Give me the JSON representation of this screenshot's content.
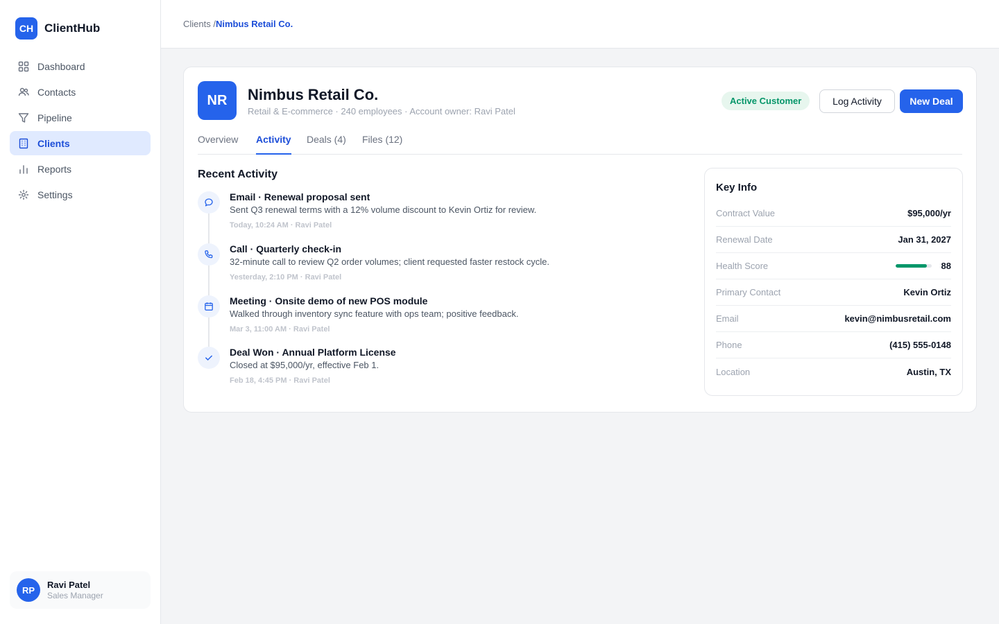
{
  "app": {
    "logo_initials": "CH",
    "name": "ClientHub"
  },
  "nav": [
    {
      "label": "Dashboard",
      "icon": "grid-icon",
      "active": false
    },
    {
      "label": "Contacts",
      "icon": "users-icon",
      "active": false
    },
    {
      "label": "Pipeline",
      "icon": "funnel-icon",
      "active": false
    },
    {
      "label": "Clients",
      "icon": "building-icon",
      "active": true
    },
    {
      "label": "Reports",
      "icon": "bar-chart-icon",
      "active": false
    },
    {
      "label": "Settings",
      "icon": "gear-icon",
      "active": false
    }
  ],
  "user": {
    "initials": "RP",
    "name": "Ravi Patel",
    "role": "Sales Manager"
  },
  "breadcrumb": {
    "parent": "Clients /",
    "current": "Nimbus Retail Co."
  },
  "client": {
    "initials": "NR",
    "name": "Nimbus Retail Co.",
    "meta": "Retail & E-commerce · 240 employees · Account owner: Ravi Patel",
    "status": "Active Customer"
  },
  "actions": {
    "log_activity": "Log Activity",
    "new_deal": "New Deal"
  },
  "tabs": [
    {
      "label": "Overview",
      "active": false
    },
    {
      "label": "Activity",
      "active": true
    },
    {
      "label": "Deals (4)",
      "active": false
    },
    {
      "label": "Files (12)",
      "active": false
    }
  ],
  "activity": {
    "title": "Recent Activity",
    "items": [
      {
        "icon": "chat-bubble-icon",
        "title": "Email · Renewal proposal sent",
        "desc": "Sent Q3 renewal terms with a 12% volume discount to Kevin Ortiz for review.",
        "time": "Today, 10:24 AM · Ravi Patel"
      },
      {
        "icon": "phone-icon",
        "title": "Call · Quarterly check-in",
        "desc": "32-minute call to review Q2 order volumes; client requested faster restock cycle.",
        "time": "Yesterday, 2:10 PM · Ravi Patel"
      },
      {
        "icon": "calendar-icon",
        "title": "Meeting · Onsite demo of new POS module",
        "desc": "Walked through inventory sync feature with ops team; positive feedback.",
        "time": "Mar 3, 11:00 AM · Ravi Patel"
      },
      {
        "icon": "check-icon",
        "title": "Deal Won · Annual Platform License",
        "desc": "Closed at $95,000/yr, effective Feb 1.",
        "time": "Feb 18, 4:45 PM · Ravi Patel"
      }
    ]
  },
  "key_info": {
    "title": "Key Info",
    "rows": [
      {
        "label": "Contract Value",
        "value": "$95,000/yr"
      },
      {
        "label": "Renewal Date",
        "value": "Jan 31, 2027"
      },
      {
        "label": "Health Score",
        "value": "88"
      },
      {
        "label": "Primary Contact",
        "value": "Kevin Ortiz"
      },
      {
        "label": "Email",
        "value": "kevin@nimbusretail.com"
      },
      {
        "label": "Phone",
        "value": "(415) 555-0148"
      },
      {
        "label": "Location",
        "value": "Austin, TX"
      }
    ],
    "health_score_fraction": 0.88,
    "health_color": "#059669"
  },
  "colors": {
    "accent": "#2563eb",
    "success": "#059669"
  }
}
